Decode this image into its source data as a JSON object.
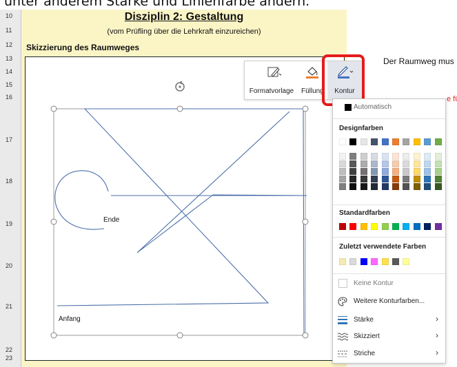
{
  "top_partial_text": "unter anderem Stärke und Linienfarbe ändern.",
  "row_headers": [
    "10",
    "11",
    "12",
    "13",
    "14",
    "15",
    "16",
    "17",
    "18",
    "19",
    "20",
    "21",
    "22",
    "23"
  ],
  "sheet": {
    "title": "Disziplin 2: Gestaltung",
    "subtitle": "(vom Prüfling über die Lehrkraft einzureichen)",
    "section_label": "Skizzierung des Raumweges",
    "right_text": "Der Raumweg mus",
    "right_red_text": "e fü"
  },
  "shape": {
    "end_label": "Ende",
    "start_label": "Anfang",
    "line_color": "#4a6ea8"
  },
  "ribbon": {
    "buttons": [
      {
        "label": "Formatvorlage",
        "icon": "format-style-icon"
      },
      {
        "label": "Füllung",
        "icon": "paint-bucket-icon"
      },
      {
        "label": "Kontur",
        "icon": "pen-outline-icon"
      }
    ],
    "highlight_color": "#e61a1a"
  },
  "menu": {
    "automatic_label": "Automatisch",
    "automatic_color": "#000000",
    "theme_colors_title": "Designfarben",
    "theme_top_row": [
      "#ffffff",
      "#000000",
      "#e7e6e6",
      "#44546a",
      "#4472c4",
      "#ed7d31",
      "#a5a5a5",
      "#ffc000",
      "#5b9bd5",
      "#70ad47"
    ],
    "theme_shades": [
      [
        "#f2f2f2",
        "#7f7f7f",
        "#d0cece",
        "#d6dce4",
        "#dae3f3",
        "#fbe5d6",
        "#ededed",
        "#fff2cc",
        "#deebf7",
        "#e2f0d9"
      ],
      [
        "#d9d9d9",
        "#595959",
        "#aeabab",
        "#adb9ca",
        "#b4c7e7",
        "#f8cbad",
        "#dbdbdb",
        "#ffe699",
        "#bdd7ee",
        "#c5e0b4"
      ],
      [
        "#bfbfbf",
        "#404040",
        "#757171",
        "#8497b0",
        "#8faadc",
        "#f4b183",
        "#c9c9c9",
        "#ffd966",
        "#9dc3e6",
        "#a9d18e"
      ],
      [
        "#a6a6a6",
        "#262626",
        "#3b3838",
        "#333f50",
        "#2f5597",
        "#c55a11",
        "#7b7b7b",
        "#bf9000",
        "#2e75b6",
        "#538135"
      ],
      [
        "#7f7f7f",
        "#0d0d0d",
        "#171717",
        "#222a35",
        "#203864",
        "#843c0c",
        "#525252",
        "#7f6000",
        "#1f4e79",
        "#385723"
      ]
    ],
    "standard_colors_title": "Standardfarben",
    "standard_colors": [
      "#c00000",
      "#ff0000",
      "#ffc000",
      "#ffff00",
      "#92d050",
      "#00b050",
      "#00b0f0",
      "#0070c0",
      "#002060",
      "#7030a0"
    ],
    "recent_colors_title": "Zuletzt verwendete Farben",
    "recent_colors": [
      "#f5eab0",
      "#d9d9d9",
      "#0000ff",
      "#ff66ff",
      "#ffe14d",
      "#595959",
      "#ffff99"
    ],
    "no_outline_label": "Keine Kontur",
    "more_colors_label": "Weitere Konturfarben...",
    "weight_label": "Stärke",
    "sketched_label": "Skizziert",
    "dashes_label": "Striche"
  }
}
